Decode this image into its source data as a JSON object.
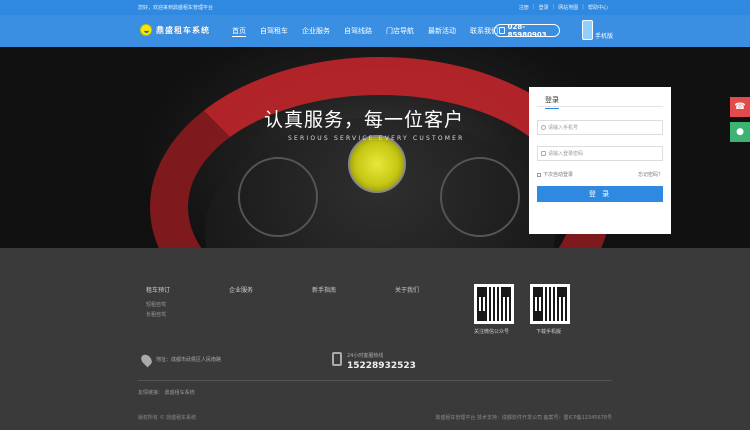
{
  "topbar": {
    "welcome": "您好，欢迎来到鼎盛租车管理平台",
    "links": [
      "注册",
      "登录",
      "网站地图",
      "帮助中心"
    ]
  },
  "brand": {
    "name": "鼎盛租车系统",
    "accent": "#3a8fe3"
  },
  "nav": {
    "items": [
      "首页",
      "自驾租车",
      "企业服务",
      "自驾线路",
      "门店导航",
      "最新活动",
      "联系我们"
    ],
    "phone": "028-85980903",
    "mobile_label": "手机版"
  },
  "banner": {
    "slogan": "认真服务，每一位客户",
    "slogan_en": "SERIOUS SERVICE EVERY CUSTOMER"
  },
  "login": {
    "tab": "登录",
    "username_placeholder": "请输入手机号",
    "password_placeholder": "请输入登录密码",
    "remember": "下次自动登录",
    "forgot": "忘记密码？",
    "submit": "登 录"
  },
  "float": {
    "phone_icon": "phone-icon",
    "qq_icon": "qq-icon"
  },
  "footer": {
    "columns": [
      {
        "title": "租车预订",
        "subs": [
          "短租自驾",
          "长租自驾"
        ]
      },
      {
        "title": "企业服务",
        "subs": []
      },
      {
        "title": "新手指南",
        "subs": []
      },
      {
        "title": "关于我们",
        "subs": []
      }
    ],
    "qr_captions": [
      "关注微信公众号",
      "下载手机版"
    ],
    "address": "地址：成都市武侯区人民南路",
    "hotline_label": "24小时客服热线",
    "hotline": "15228932523",
    "friend_links": "友情链接：  鼎盛租车系统",
    "copyright_left": "版权所有 © 鼎盛租车系统",
    "copyright_right": "鼎盛租车管理平台 技术支持：成都软件开发公司  备案号：蜀ICP备12345678号"
  }
}
